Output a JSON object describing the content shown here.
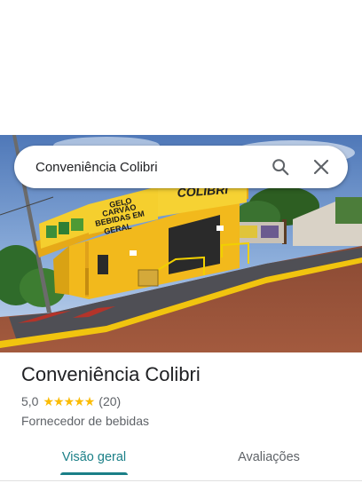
{
  "search": {
    "query": "Conveniência Colibri"
  },
  "photo": {
    "signs": {
      "gelo": "GELO",
      "carvao": "CARVÃO",
      "bebidas": "BEBIDAS EM",
      "geral": "GERAL",
      "colibri": "COLIBRI"
    }
  },
  "place": {
    "name": "Conveniência Colibri",
    "rating": "5,0",
    "stars": 5,
    "review_count": "(20)",
    "category": "Fornecedor de bebidas"
  },
  "tabs": [
    {
      "label": "Visão geral",
      "active": true
    },
    {
      "label": "Avaliações",
      "active": false
    }
  ],
  "colors": {
    "accent": "#1a7f87",
    "star": "#fbbc04",
    "building": "#f2b91c"
  }
}
